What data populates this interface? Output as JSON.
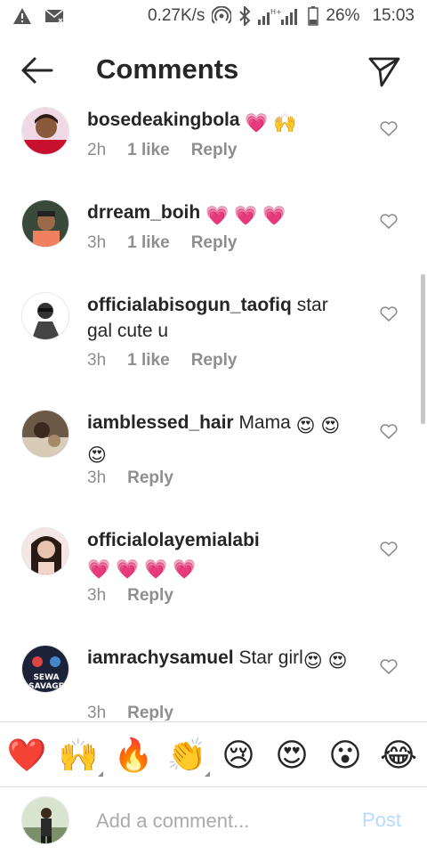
{
  "status_bar": {
    "net_speed": "0.27K/s",
    "battery": "26%",
    "time": "15:03",
    "icons": [
      "warning-icon",
      "message-icon",
      "wifi-hotspot-icon",
      "bluetooth-icon",
      "signal-icon",
      "battery-icon"
    ]
  },
  "header": {
    "title": "Comments",
    "back_icon": "arrow-left-icon",
    "send_icon": "paper-plane-icon"
  },
  "comments": [
    {
      "user": "bosedeakingbola",
      "text": "",
      "emojis": [
        "💗",
        "🙌"
      ],
      "time": "2h",
      "likes": "1 like",
      "reply": "Reply"
    },
    {
      "user": "drream_boih",
      "text": "",
      "emojis": [
        "💗",
        "💗",
        "💗"
      ],
      "time": "3h",
      "likes": "1 like",
      "reply": "Reply"
    },
    {
      "user": "officialabisogun_taofiq",
      "text": "star gal cute u",
      "emojis": [],
      "time": "3h",
      "likes": "1 like",
      "reply": "Reply"
    },
    {
      "user": "iamblessed_hair",
      "text": "Mama",
      "emojis": [
        "😍",
        "😍",
        "😍"
      ],
      "time": "3h",
      "likes": "",
      "reply": "Reply"
    },
    {
      "user": "officialolayemialabi",
      "text": "",
      "emojis": [
        "💗",
        "💗",
        "💗",
        "💗"
      ],
      "time": "3h",
      "likes": "",
      "reply": "Reply"
    },
    {
      "user": "iamrachysamuel",
      "text": "Star girl",
      "emojis": [
        "😍",
        "😍"
      ],
      "time": "3h",
      "likes": "",
      "reply": "Reply"
    }
  ],
  "avatar_badge": {
    "line1": "SEWA",
    "line2": "SAVAGE"
  },
  "reactions": [
    "❤️",
    "🙌",
    "🔥",
    "👏",
    "😢",
    "😍",
    "😮",
    "😂"
  ],
  "input": {
    "placeholder": "Add a comment...",
    "post_label": "Post"
  },
  "colors": {
    "text": "#262626",
    "muted": "#8e8e8e",
    "post_disabled": "#b3dbff",
    "heart_pink": "#e84a8a"
  }
}
